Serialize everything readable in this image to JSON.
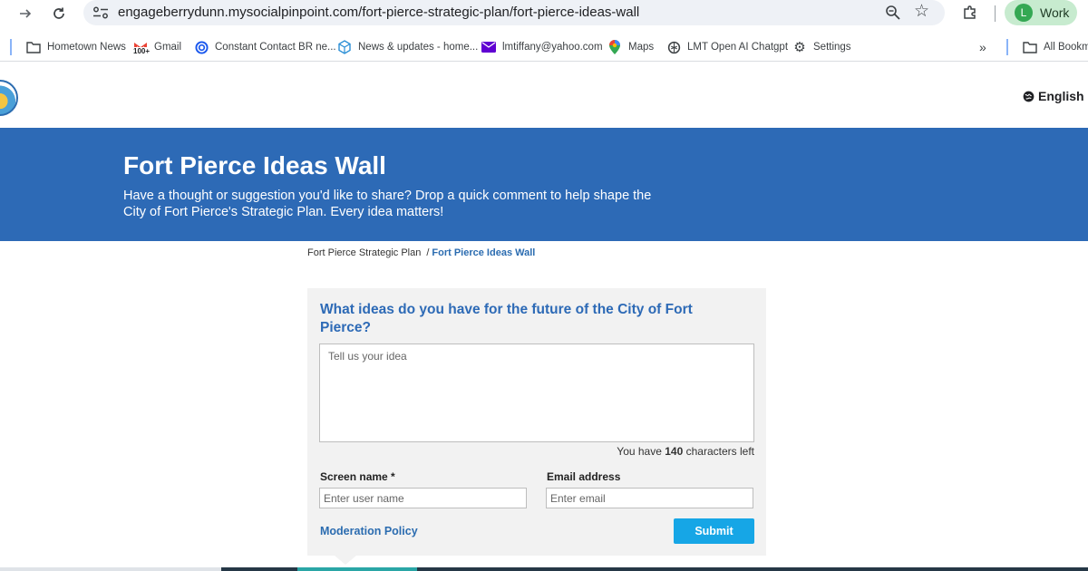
{
  "browser": {
    "url": "engageberrydunn.mysocialpinpoint.com/fort-pierce-strategic-plan/fort-pierce-ideas-wall",
    "profile_initial": "L",
    "profile_label": "Work",
    "icons": [
      "forward-arrow-icon",
      "reload-icon",
      "site-settings-icon",
      "zoom-icon",
      "star-icon",
      "extensions-icon"
    ]
  },
  "bookmarks": {
    "items": [
      {
        "label": "Hometown News",
        "icon": "folder-icon"
      },
      {
        "label": "Gmail",
        "icon": "gmail-icon",
        "badge": "100+"
      },
      {
        "label": "Constant Contact BR ne...",
        "icon": "constant-contact-icon"
      },
      {
        "label": "News & updates - home...",
        "icon": "news-icon"
      },
      {
        "label": "lmtiffany@yahoo.com",
        "icon": "mail-icon"
      },
      {
        "label": "Maps",
        "icon": "maps-pin-icon"
      },
      {
        "label": "LMT Open AI Chatgpt",
        "icon": "openai-icon"
      },
      {
        "label": "Settings",
        "icon": "gear-icon"
      }
    ],
    "more": "»",
    "all_bookmarks": "All Bookm"
  },
  "header": {
    "language": "English"
  },
  "banner": {
    "title": "Fort Pierce Ideas Wall",
    "description": "Have a thought or suggestion you'd like to share? Drop a quick comment to help shape the City of Fort Pierce's Strategic Plan. Every idea matters!"
  },
  "breadcrumb": {
    "parent": "Fort Pierce Strategic Plan",
    "separator": "/",
    "current": "Fort Pierce Ideas Wall"
  },
  "form": {
    "question": "What ideas do you have for the future of the City of Fort Pierce?",
    "idea_placeholder": "Tell us your idea",
    "chars_prefix": "You have",
    "chars_count": "140",
    "chars_suffix": "characters left",
    "screen_name_label": "Screen name *",
    "screen_name_placeholder": "Enter user name",
    "email_label": "Email address",
    "email_placeholder": "Enter email",
    "moderation_link": "Moderation Policy",
    "submit_label": "Submit"
  },
  "colors": {
    "banner": "#2d6ab6",
    "accent_link": "#2b6cb0",
    "submit": "#16a6e6",
    "card_bg": "#f2f2f2"
  }
}
